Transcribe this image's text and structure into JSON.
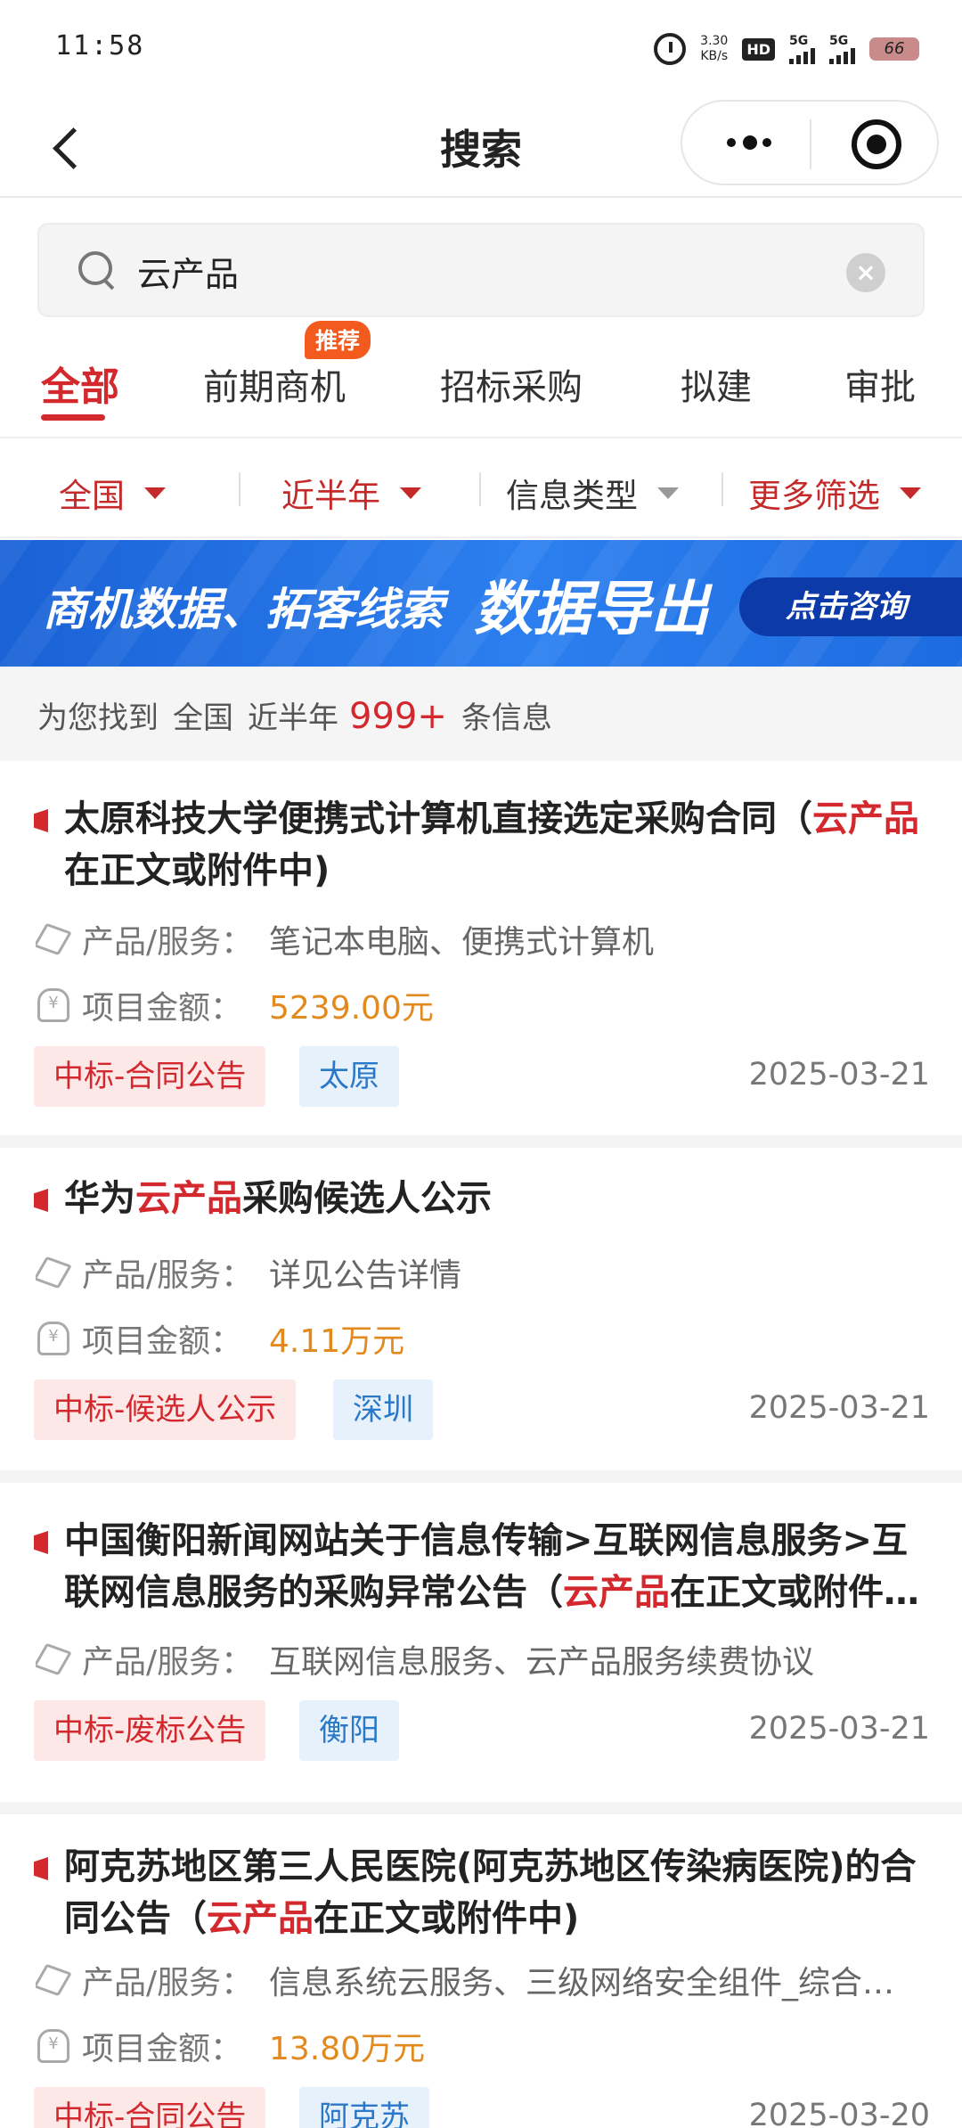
{
  "status_bar": {
    "time": "11:58",
    "speed_value": "3.30",
    "speed_unit": "KB/s",
    "hd_label": "HD",
    "sig1": "5G",
    "sig2": "5G",
    "battery": "66"
  },
  "nav": {
    "title": "搜索"
  },
  "search": {
    "value": "云产品"
  },
  "tabs": [
    {
      "label": "全部",
      "active": true
    },
    {
      "label": "前期商机",
      "badge": "推荐"
    },
    {
      "label": "招标采购"
    },
    {
      "label": "拟建"
    },
    {
      "label": "审批"
    }
  ],
  "filters": [
    {
      "label": "全国"
    },
    {
      "label": "近半年"
    },
    {
      "label": "信息类型"
    },
    {
      "label": "更多筛选"
    }
  ],
  "banner": {
    "text": "商机数据、拓客线索",
    "highlight": "数据导出",
    "button": "点击咨询"
  },
  "summary": {
    "prefix": "为您找到",
    "region": "全国",
    "period": "近半年",
    "count": "999+",
    "suffix": "条信息"
  },
  "labels": {
    "product": "产品/服务：",
    "amount": "项目金额："
  },
  "results": [
    {
      "title_parts": [
        "太原科技大学便携式计算机直接选定采购合同（",
        "云产品",
        "在正文或附件中)"
      ],
      "product": "笔记本电脑、便携式计算机",
      "amount": "5239.00元",
      "tag_type": "中标-合同公告",
      "tag_region": "太原",
      "date": "2025-03-21"
    },
    {
      "title_parts": [
        "华为",
        "云产品",
        "采购候选人公示"
      ],
      "product": "详见公告详情",
      "amount": "4.11万元",
      "tag_type": "中标-候选人公示",
      "tag_region": "深圳",
      "date": "2025-03-21"
    },
    {
      "title_parts": [
        "中国衡阳新闻网站关于信息传输>互联网信息服务>互联网信息服务的采购异常公告（",
        "云产品",
        "在正文或附件中)"
      ],
      "product": "互联网信息服务、云产品服务续费协议",
      "tag_type": "中标-废标公告",
      "tag_region": "衡阳",
      "date": "2025-03-21"
    },
    {
      "title_parts": [
        "阿克苏地区第三人民医院(阿克苏地区传染病医院)的合同公告（",
        "云产品",
        "在正文或附件中)"
      ],
      "product": "信息系统云服务、三级网络安全组件_综合审计、软件开发服务",
      "amount": "13.80万元",
      "tag_type": "中标-合同公告",
      "tag_region": "阿克苏",
      "date": "2025-03-20"
    }
  ]
}
